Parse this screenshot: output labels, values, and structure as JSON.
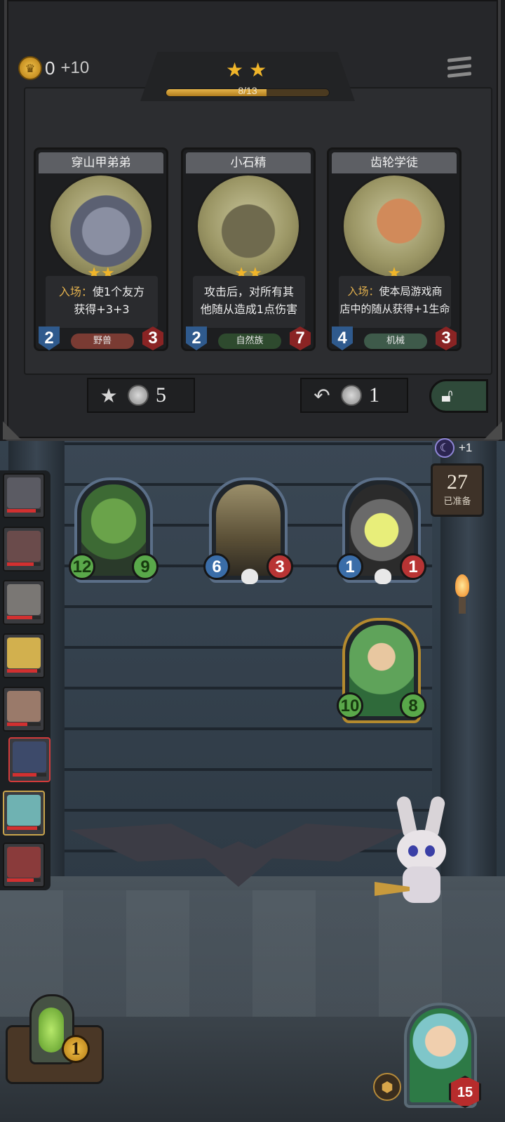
{
  "shop": {
    "gold": "0",
    "gold_income": "+10",
    "tier_stars": 2,
    "xp_text": "8/13",
    "xp_fraction": 0.615,
    "cards": [
      {
        "name": "穿山甲弟弟",
        "stars": 2,
        "desc_keyword": "入场：",
        "desc_rest": "使1个友方获得+3+3",
        "desc_line1": "使1个友方",
        "desc_line2": "获得+3+3",
        "attack": "2",
        "health": "3",
        "tribe": "野兽",
        "tribe_color": "#7a3b33"
      },
      {
        "name": "小石精",
        "stars": 2,
        "desc_keyword": "",
        "desc_line1": "攻击后，对所有其",
        "desc_line2": "他随从造成1点伤害",
        "attack": "2",
        "health": "7",
        "tribe": "自然族",
        "tribe_color": "#2e4a2e"
      },
      {
        "name": "齿轮学徒",
        "stars": 1,
        "desc_keyword": "入场：",
        "desc_line1": "使本局游戏商",
        "desc_line2": "店中的随从获得+1生命",
        "attack": "4",
        "health": "3",
        "tribe": "机械",
        "tribe_color": "#3e5a4a"
      }
    ],
    "upgrade_cost": "5",
    "refresh_cost": "1"
  },
  "round": {
    "increment": "+1",
    "timer": "27",
    "timer_label": "已准备"
  },
  "heroes": [
    {
      "slot": "hero-1",
      "hp_fraction": 0.85
    },
    {
      "slot": "hero-2",
      "hp_fraction": 0.8
    },
    {
      "slot": "hero-3",
      "hp_fraction": 0.75
    },
    {
      "slot": "hero-4",
      "hp_fraction": 0.9
    },
    {
      "slot": "hero-5",
      "hp_fraction": 0.6
    },
    {
      "slot": "hero-6",
      "hp_fraction": 0.7
    },
    {
      "slot": "hero-7",
      "hp_fraction": 0.9
    },
    {
      "slot": "hero-8",
      "hp_fraction": 0.8
    }
  ],
  "minions": [
    {
      "attack": "12",
      "health": "9",
      "green_stats": true
    },
    {
      "attack": "6",
      "health": "3",
      "green_stats": false,
      "skull": true
    },
    {
      "attack": "1",
      "health": "1",
      "green_stats": false,
      "skull": true
    },
    {
      "attack": "10",
      "health": "8",
      "green_stats": true,
      "gold_frame": true
    }
  ],
  "hud": {
    "hero_power_cost": "1",
    "player_health": "15"
  },
  "icons": {
    "gold": "crown-coin-icon",
    "menu": "menu-icon",
    "upgrade": "star-up-icon",
    "refresh": "refresh-icon",
    "freeze": "lock-icon",
    "round": "moon-icon"
  }
}
